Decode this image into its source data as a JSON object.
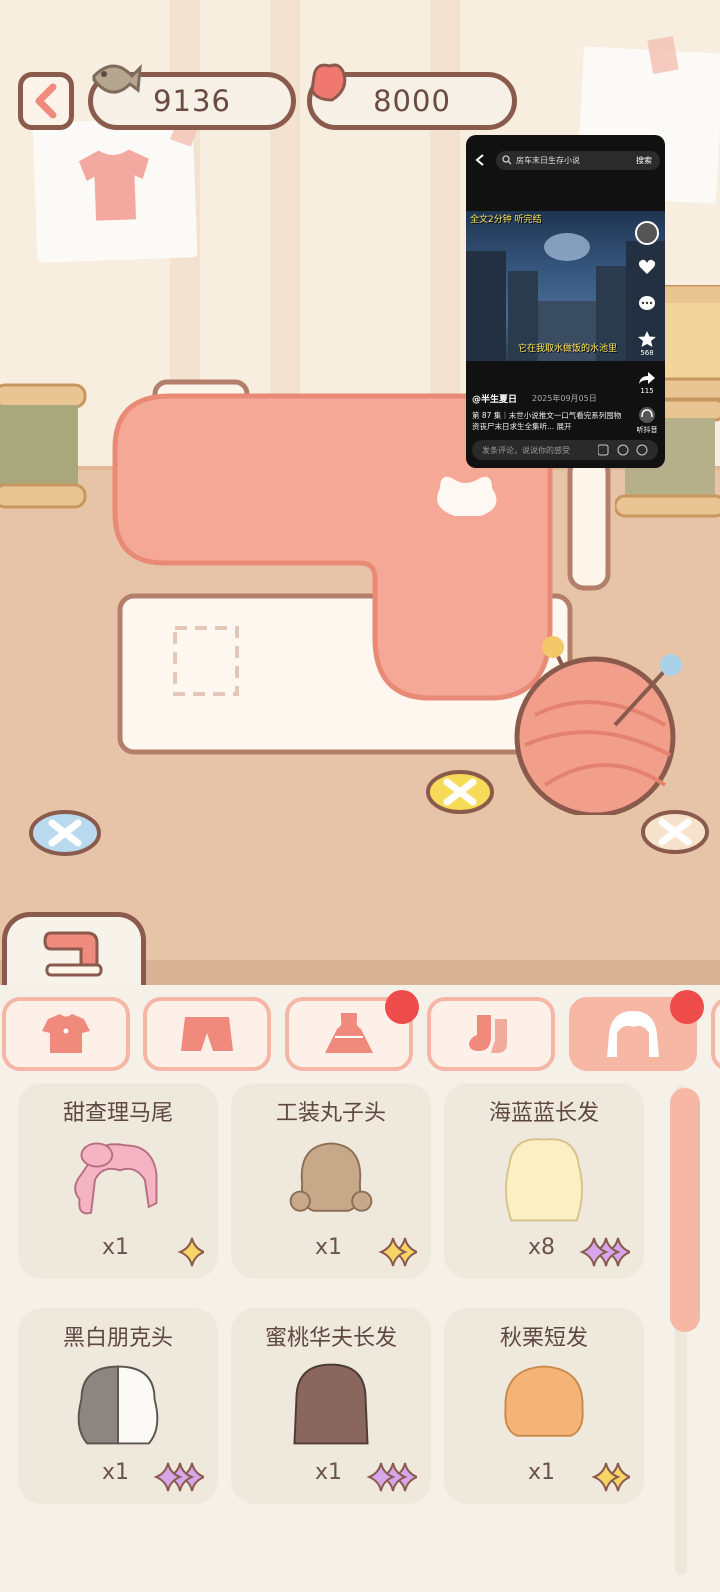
{
  "currency": {
    "fish": "9136",
    "yarn": "8000"
  },
  "popup": {
    "search_query": "房车末日生存小说",
    "search_button": "搜索",
    "tag_text": "全文2分钟 听完结",
    "caption": "它在我取水做饭的水池里",
    "likes": "",
    "stars": "568",
    "shares": "115",
    "listen_label": "听抖音",
    "author": "@半生夏日",
    "date": "2025年09月05日",
    "description": "第 87 集｜末世小说推文一口气看完系列囤物资丧尸末日求生全集听... 展开",
    "comment_placeholder": "发条评论，说说你的感受"
  },
  "colors": {
    "accent": "#f7b7a5",
    "outline": "#8a5b4d",
    "red_dot": "#ee4b4b"
  },
  "categories": [
    {
      "icon": "shirt-icon",
      "active": false,
      "dot": false
    },
    {
      "icon": "shorts-icon",
      "active": false,
      "dot": false
    },
    {
      "icon": "dress-icon",
      "active": false,
      "dot": true
    },
    {
      "icon": "socks-icon",
      "active": false,
      "dot": false
    },
    {
      "icon": "hair-icon",
      "active": true,
      "dot": true
    }
  ],
  "items": [
    {
      "name": "甜查理马尾",
      "count": "x1",
      "rarity": 1,
      "color": "#f5b4c3"
    },
    {
      "name": "工装丸子头",
      "count": "x1",
      "rarity": 2,
      "color": "#c7a98a"
    },
    {
      "name": "海蓝蓝长发",
      "count": "x8",
      "rarity": 3,
      "color": "#fbefc3"
    },
    {
      "name": "黑白朋克头",
      "count": "x1",
      "rarity": 3,
      "color": "#8d8680"
    },
    {
      "name": "蜜桃华夫长发",
      "count": "x1",
      "rarity": 3,
      "color": "#8a675e"
    },
    {
      "name": "秋栗短发",
      "count": "x1",
      "rarity": 2,
      "color": "#f4b477"
    }
  ]
}
